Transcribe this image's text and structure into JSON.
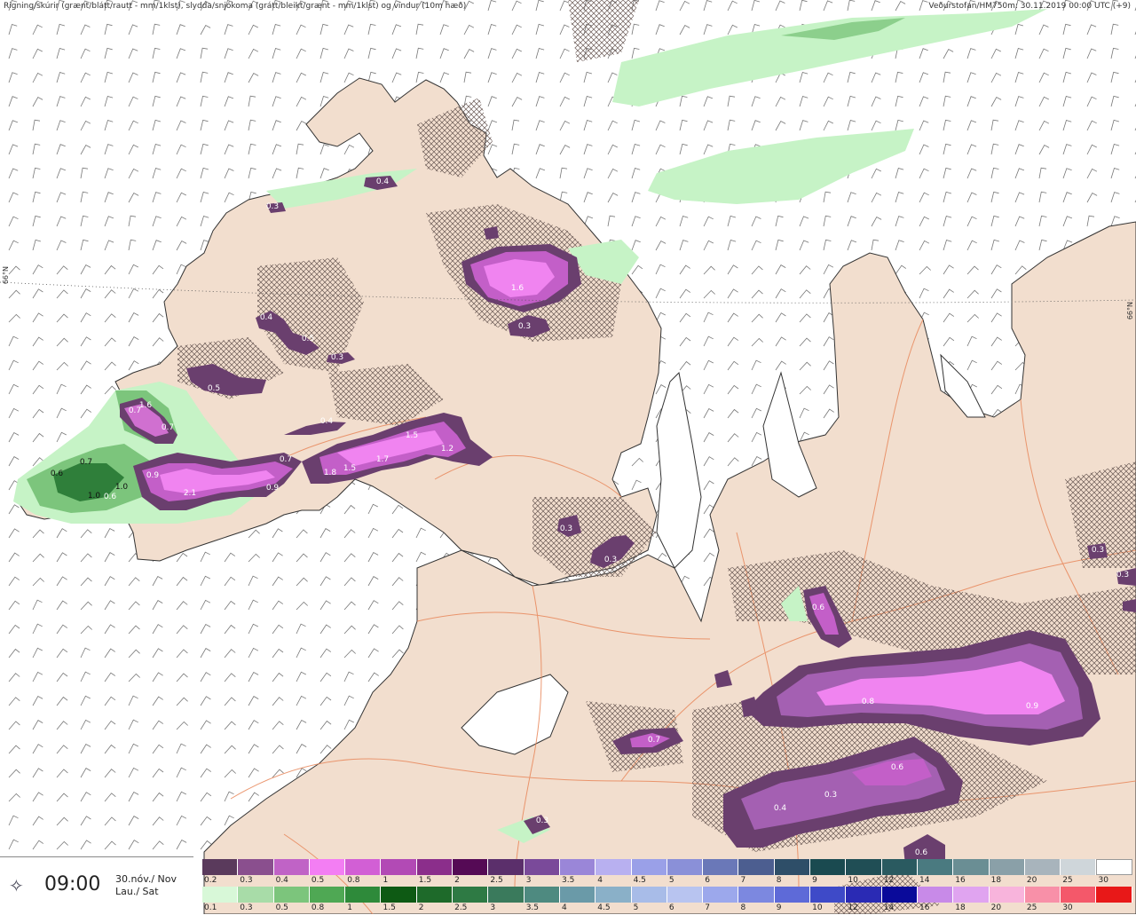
{
  "header": {
    "left": "Rigning/skúrir (grænt/blátt/rautt - mm/1klst), slydda/snjókoma (grátt/bleikt/grænt - mm/1klst) og vindur (10m hæð)",
    "right": "Veðurstofan/HM750m: 30.11.2019 00:00 UTC (+9)"
  },
  "grid_labels": {
    "left": "66°N",
    "right": "66°N"
  },
  "time": {
    "value": "09:00",
    "date_line1": "30.nóv./ Nov",
    "date_line2": "Lau./ Sat"
  },
  "icon_names": {
    "nav": "compass-star-icon"
  },
  "colors": {
    "land": "#f2dece",
    "coast": "#333333",
    "roads": "#e8875a",
    "snow_dark": "#5e3a63",
    "snow_mid": "#a05cb5",
    "snow_bright": "#e87ae8",
    "rain_light": "#b9f0b9",
    "rain_mid": "#7cc57c",
    "rain_dark": "#2f7f3a"
  },
  "legend_snow": {
    "colors": [
      "#5a3a5c",
      "#8a4f8e",
      "#c063c6",
      "#f37ef3",
      "#d25fd5",
      "#b24ab5",
      "#8b2e8b",
      "#550a55",
      "#5b2f6b",
      "#7a4a9a",
      "#9a86d8",
      "#b8b0f0",
      "#9aa0e8",
      "#8a90d8",
      "#6a78b8",
      "#4c5e90",
      "#2e4e68",
      "#1a4a50",
      "#204e55",
      "#2a5a60",
      "#4a7a80",
      "#6a8e94",
      "#8aa0a8",
      "#a8b4bc",
      "#cfd6da",
      "#ffffff"
    ],
    "labels": [
      "0.2",
      "0.3",
      "0.4",
      "0.5",
      "0.8",
      "1",
      "1.5",
      "2",
      "2.5",
      "3",
      "3.5",
      "4",
      "4.5",
      "5",
      "6",
      "7",
      "8",
      "9",
      "10",
      "12",
      "14",
      "16",
      "18",
      "20",
      "25",
      "30"
    ]
  },
  "legend_rain": {
    "colors": [
      "#d8f8d8",
      "#a8dca8",
      "#7cc57c",
      "#4fa854",
      "#2e8a3a",
      "#0e5a14",
      "#1e6a2a",
      "#2e7a44",
      "#3a7a5c",
      "#4e8a80",
      "#6a9aa8",
      "#8ab0c8",
      "#a8bce8",
      "#b8c4f0",
      "#9ca8ec",
      "#7c88e0",
      "#5e6ad8",
      "#3e4ac8",
      "#2a2ab4",
      "#0a0a9a",
      "#c88ae8",
      "#e0a4f0",
      "#f8b4dc",
      "#f890a8",
      "#f4586a",
      "#e81818"
    ],
    "labels": [
      "0.1",
      "0.3",
      "0.5",
      "0.8",
      "1",
      "1.5",
      "2",
      "2.5",
      "3",
      "3.5",
      "4",
      "4.5",
      "5",
      "6",
      "7",
      "8",
      "9",
      "10",
      "12",
      "14",
      "16",
      "18",
      "20",
      "25",
      "30"
    ]
  },
  "values": [
    {
      "text": "1.6",
      "dark": false
    },
    {
      "text": "0.3",
      "dark": false
    },
    {
      "text": "0.4",
      "dark": false
    },
    {
      "text": "0.5",
      "dark": false
    },
    {
      "text": "0.4",
      "dark": false
    },
    {
      "text": "0.3",
      "dark": false
    },
    {
      "text": "0.3",
      "dark": false
    },
    {
      "text": "0.5",
      "dark": false
    },
    {
      "text": "0.7",
      "dark": false
    },
    {
      "text": "1.6",
      "dark": false
    },
    {
      "text": "0.7",
      "dark": false
    },
    {
      "text": "0.4",
      "dark": false
    },
    {
      "text": "1.5",
      "dark": false
    },
    {
      "text": "1.2",
      "dark": false
    },
    {
      "text": "1.7",
      "dark": false
    },
    {
      "text": "1.5",
      "dark": false
    },
    {
      "text": "1.8",
      "dark": false
    },
    {
      "text": "0.7",
      "dark": false
    },
    {
      "text": "0.9",
      "dark": false
    },
    {
      "text": "2.1",
      "dark": false
    },
    {
      "text": "0.9",
      "dark": false
    },
    {
      "text": "0.6",
      "dark": true
    },
    {
      "text": "0.7",
      "dark": true
    },
    {
      "text": "1.0",
      "dark": true
    },
    {
      "text": "1.0",
      "dark": true
    },
    {
      "text": "0.6",
      "dark": false
    },
    {
      "text": "0.3",
      "dark": false
    },
    {
      "text": "0.3",
      "dark": false
    },
    {
      "text": "0.6",
      "dark": false
    },
    {
      "text": "0.8",
      "dark": false
    },
    {
      "text": "0.9",
      "dark": false
    },
    {
      "text": "0.6",
      "dark": false
    },
    {
      "text": "0.4",
      "dark": false
    },
    {
      "text": "0.3",
      "dark": false
    },
    {
      "text": "0.7",
      "dark": false
    },
    {
      "text": "0.3",
      "dark": false
    },
    {
      "text": "0.6",
      "dark": false
    },
    {
      "text": "0.3",
      "dark": false
    },
    {
      "text": "0.3",
      "dark": false
    }
  ]
}
